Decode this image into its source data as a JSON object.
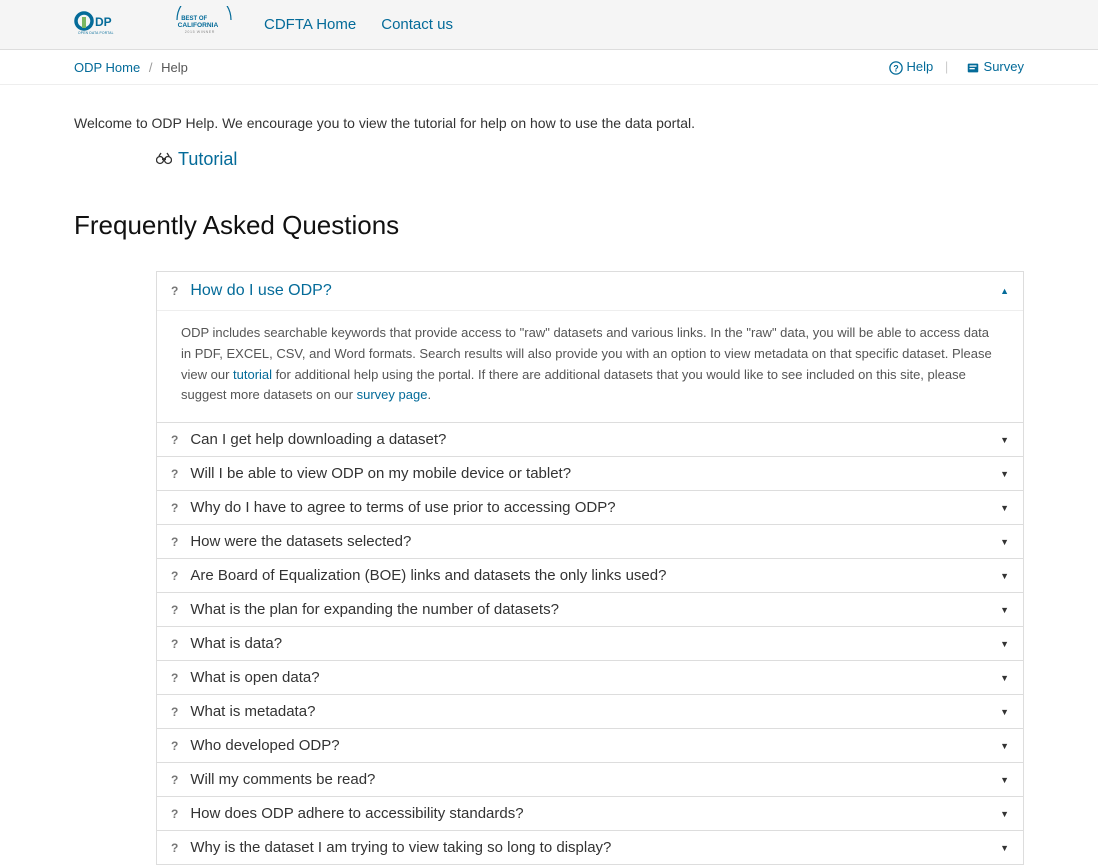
{
  "nav": {
    "cdfta_home": "CDFTA Home",
    "contact_us": "Contact us"
  },
  "breadcrumb": {
    "home": "ODP Home",
    "current": "Help"
  },
  "top_links": {
    "help": "Help",
    "survey": "Survey"
  },
  "welcome": "Welcome to ODP Help. We encourage you to view the tutorial for help on how to use the data portal.",
  "tutorial_label": "Tutorial",
  "faq_title": "Frequently Asked Questions",
  "faq": {
    "expanded": {
      "q": "How do I use ODP?",
      "a_pre": "ODP includes searchable keywords that provide access to \"raw\" datasets and various links. In the \"raw\" data, you will be able to access data in PDF, EXCEL, CSV, and Word formats. Search results will also provide you with an option to view metadata on that specific dataset. Please view our ",
      "a_link1": "tutorial",
      "a_mid": " for additional help using the portal. If there are additional datasets that you would like to see included on this site, please suggest more datasets on our ",
      "a_link2": "survey page",
      "a_post": "."
    },
    "items": [
      "Can I get help downloading a dataset?",
      "Will I be able to view ODP on my mobile device or tablet?",
      "Why do I have to agree to terms of use prior to accessing ODP?",
      "How were the datasets selected?",
      "Are Board of Equalization (BOE) links and datasets the only links used?",
      "What is the plan for expanding the number of datasets?",
      "What is data?",
      "What is open data?",
      "What is metadata?",
      "Who developed ODP?",
      "Will my comments be read?",
      "How does ODP adhere to accessibility standards?",
      "Why is the dataset I am trying to view taking so long to display?"
    ]
  }
}
